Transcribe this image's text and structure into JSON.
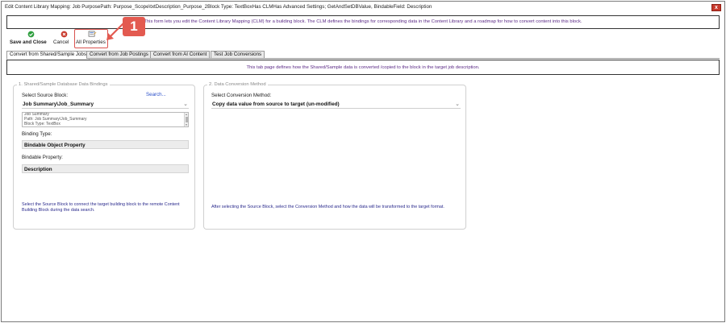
{
  "window": {
    "title": "Edit Content Library Mapping: Job PurposePath: Purpose_Scope\\txtDescription_Purpose_2Block Type: TextBoxHas CLMHas Advanced Settings; GetAndSetDBValue, BindableField: Description",
    "close_glyph": "x"
  },
  "info_bar": {
    "text": "This form lets you edit the Content Library Mapping (CLM) for a building block. The CLM defines the bindings for corresponding data in the Content Library and a roadmap for how to convert content into this block."
  },
  "toolbar": {
    "save_close_label": "Save and Close",
    "cancel_label": "Cancel",
    "all_properties_label": "All Properties"
  },
  "callout": {
    "number": "1"
  },
  "tabs": [
    {
      "label": "Convert from Shared/Sample Jobs",
      "active": true
    },
    {
      "label": "Convert from Job Postings",
      "active": false
    },
    {
      "label": "Convert from AI Content",
      "active": false
    },
    {
      "label": "Test Job Conversions",
      "active": false
    }
  ],
  "tab_info": {
    "text": "This tab page defines how the Shared/Sample data is converted /copied to the block in the target job description."
  },
  "left_panel": {
    "legend": "1. Shared/Sample Database Data Bindings",
    "source_block_label": "Select Source Block:",
    "search_link": "Search...",
    "source_block_value": "Job Summary\\Job_Summary",
    "details": [
      "Job Summary",
      "Path: Job Summary\\Job_Summary",
      "Block Type: TextBox"
    ],
    "binding_type_label": "Binding Type:",
    "binding_type_value": "Bindable Object Property",
    "bindable_property_label": "Bindable Property:",
    "bindable_property_value": "Description",
    "help": "Select the Source Block to connect the target building block to the remote Content Building Block during the data search."
  },
  "right_panel": {
    "legend": "2. Data Conversion Method",
    "method_label": "Select Conversion Method:",
    "method_value": "Copy data value from source to target (un-modified)",
    "help": "After selecting the Source Block, select the Conversion Method and how the data will be transformed to the target format."
  },
  "colors": {
    "accent_purple": "#5b2a86",
    "help_blue": "#2a2a8c",
    "link_blue": "#2a4fc9",
    "callout_red": "#e35a50",
    "save_green": "#2e9e3e",
    "cancel_red": "#c8392c"
  },
  "icons": {
    "save": "check-circle-icon",
    "cancel": "x-circle-icon",
    "all_properties": "properties-icon",
    "dropdown": "chevron-down-icon"
  }
}
